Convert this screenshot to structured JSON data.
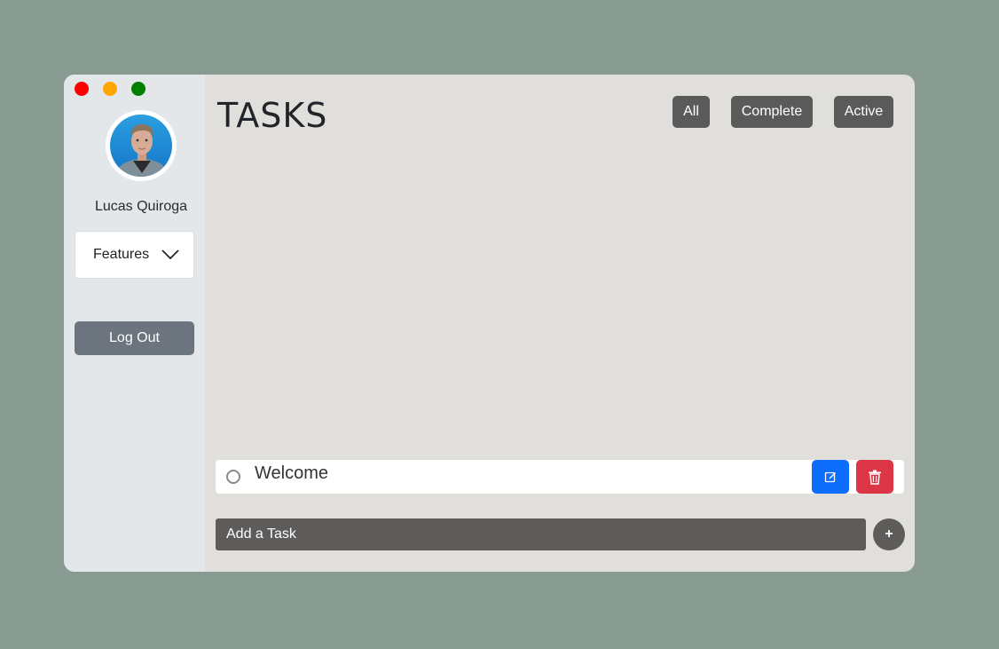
{
  "user": {
    "name": "Lucas Quiroga"
  },
  "sidebar": {
    "features_label": "Features",
    "logout_label": "Log Out"
  },
  "main": {
    "title": "TASKS",
    "filters": [
      "All",
      "Complete",
      "Active"
    ]
  },
  "tasks": [
    {
      "text": "Welcome",
      "completed": false
    }
  ],
  "add_task": {
    "placeholder": "Add a Task",
    "button_label": "+"
  },
  "colors": {
    "background": "#879b92",
    "sidebar": "#e3e7ea",
    "main": "#e0dfdb",
    "filter_button": "#5a5a5a",
    "edit": "#0d6efd",
    "delete": "#dc3545",
    "logout": "#6c757d"
  },
  "icons": {
    "window_controls": [
      "close-dot",
      "minimize-dot",
      "maximize-dot"
    ],
    "features": "chevron-down-icon",
    "edit": "edit-icon",
    "delete": "trash-icon",
    "add": "plus-icon"
  }
}
